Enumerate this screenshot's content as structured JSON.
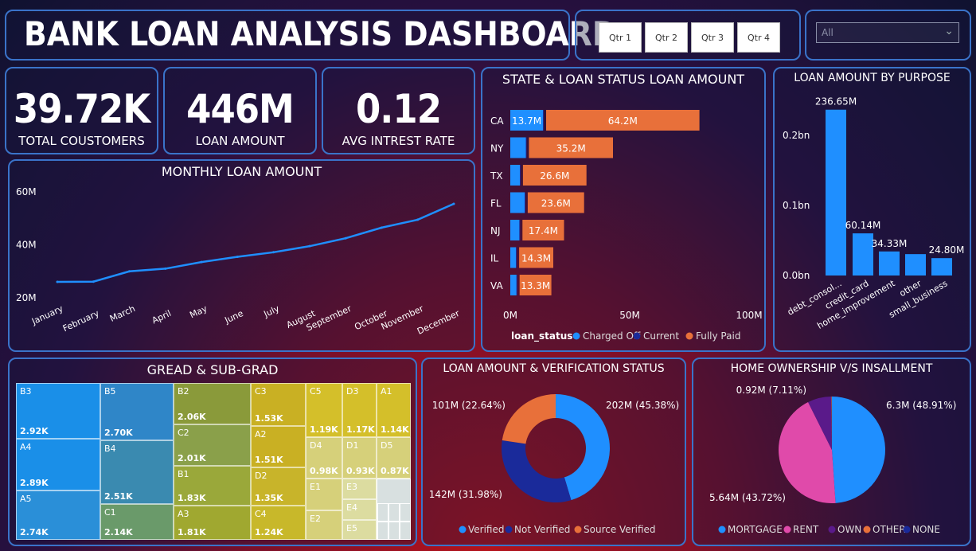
{
  "header": {
    "title": "BANK LOAN ANALYSIS DASHBOARD"
  },
  "quarters": [
    "Qtr 1",
    "Qtr 2",
    "Qtr 3",
    "Qtr 4"
  ],
  "filter": {
    "value": "All"
  },
  "kpis": {
    "total_customers": {
      "value": "39.72K",
      "label": "TOTAL COUSTOMERS"
    },
    "loan_amount": {
      "value": "446M",
      "label": "LOAN AMOUNT"
    },
    "avg_rate": {
      "value": "0.12",
      "label": "AVG INTREST RATE"
    }
  },
  "colors": {
    "blue": "#1f8fff",
    "navy": "#1a2a9a",
    "orange": "#e8703a",
    "pink": "#e04aaa",
    "purple": "#5a1a8a"
  },
  "chart_data": [
    {
      "type": "line",
      "title": "MONTHLY LOAN AMOUNT",
      "x": [
        "January",
        "February",
        "March",
        "April",
        "May",
        "June",
        "July",
        "August",
        "September",
        "October",
        "November",
        "December"
      ],
      "series": [
        {
          "values": [
            26,
            26.1,
            30,
            31,
            33.5,
            35.5,
            37.2,
            39.5,
            42.5,
            46.5,
            49.5,
            55.5
          ]
        }
      ],
      "yticks": [
        "60M",
        "40M",
        "20M"
      ],
      "ylim": [
        20,
        60
      ]
    },
    {
      "type": "bar",
      "title": "STATE & LOAN STATUS LOAN AMOUNT",
      "categories": [
        "CA",
        "NY",
        "TX",
        "FL",
        "NJ",
        "IL",
        "VA"
      ],
      "series": [
        {
          "name": "Charged Off",
          "values": [
            13.7,
            6.5,
            4.0,
            6.0,
            3.8,
            2.4,
            2.6
          ],
          "labels": [
            "13.7M",
            "",
            "",
            "",
            "",
            "",
            ""
          ]
        },
        {
          "name": "Current",
          "values": [
            0.3,
            0.3,
            0.3,
            0.3,
            0.3,
            0.3,
            0.3
          ],
          "labels": [
            "",
            "",
            "",
            "",
            "",
            "",
            ""
          ]
        },
        {
          "name": "Fully Paid",
          "values": [
            64.2,
            35.2,
            26.6,
            23.6,
            17.4,
            14.3,
            13.3
          ],
          "labels": [
            "64.2M",
            "35.2M",
            "26.6M",
            "23.6M",
            "17.4M",
            "14.3M",
            "13.3M"
          ]
        }
      ],
      "xticks": [
        "0M",
        "50M",
        "100M"
      ],
      "xlim": [
        0,
        100
      ],
      "legend_title": "loan_status"
    },
    {
      "type": "bar",
      "title": "LOAN AMOUNT BY PURPOSE",
      "categories": [
        "debt_consol...",
        "credit_card",
        "home_improvement",
        "other",
        "small_business"
      ],
      "values": [
        236.65,
        60.14,
        34.33,
        30.5,
        24.8
      ],
      "labels": [
        "236.65M",
        "60.14M",
        "34.33M",
        "",
        "24.80M"
      ],
      "yticks": [
        "0.2bn",
        "0.1bn",
        "0.0bn"
      ],
      "ylim": [
        0,
        250
      ]
    },
    {
      "type": "table",
      "title": "GREAD & SUB-GRAD",
      "cells": [
        {
          "label": "B3",
          "value": "2.92K"
        },
        {
          "label": "A4",
          "value": "2.89K"
        },
        {
          "label": "A5",
          "value": "2.74K"
        },
        {
          "label": "B5",
          "value": "2.70K"
        },
        {
          "label": "B4",
          "value": "2.51K"
        },
        {
          "label": "C1",
          "value": "2.14K"
        },
        {
          "label": "B2",
          "value": "2.06K"
        },
        {
          "label": "C2",
          "value": "2.01K"
        },
        {
          "label": "B1",
          "value": "1.83K"
        },
        {
          "label": "A3",
          "value": "1.81K"
        },
        {
          "label": "C3",
          "value": "1.53K"
        },
        {
          "label": "A2",
          "value": "1.51K"
        },
        {
          "label": "D2",
          "value": "1.35K"
        },
        {
          "label": "C4",
          "value": "1.24K"
        },
        {
          "label": "C5",
          "value": "1.19K"
        },
        {
          "label": "D3",
          "value": "1.17K"
        },
        {
          "label": "A1",
          "value": "1.14K"
        },
        {
          "label": "D4",
          "value": "0.98K"
        },
        {
          "label": "D1",
          "value": "0.93K"
        },
        {
          "label": "D5",
          "value": "0.87K"
        },
        {
          "label": "E1",
          "value": ""
        },
        {
          "label": "E3",
          "value": ""
        },
        {
          "label": "E4",
          "value": ""
        },
        {
          "label": "E2",
          "value": ""
        },
        {
          "label": "E5",
          "value": ""
        }
      ]
    },
    {
      "type": "pie",
      "title": "LOAN AMOUNT & VERIFICATION STATUS",
      "categories": [
        "Verified",
        "Not Verified",
        "Source Verified"
      ],
      "values": [
        45.38,
        31.98,
        22.64
      ],
      "labels": [
        "202M (45.38%)",
        "142M (31.98%)",
        "101M (22.64%)"
      ],
      "donut": true
    },
    {
      "type": "pie",
      "title": "HOME OWNERSHIP V/S INSALLMENT",
      "categories": [
        "MORTGAGE",
        "RENT",
        "OWN",
        "OTHER",
        "NONE"
      ],
      "values": [
        48.91,
        43.72,
        7.11,
        0.18,
        0.08
      ],
      "labels": [
        "6.3M (48.91%)",
        "5.64M (43.72%)",
        "0.92M (7.11%)",
        "",
        ""
      ]
    }
  ]
}
